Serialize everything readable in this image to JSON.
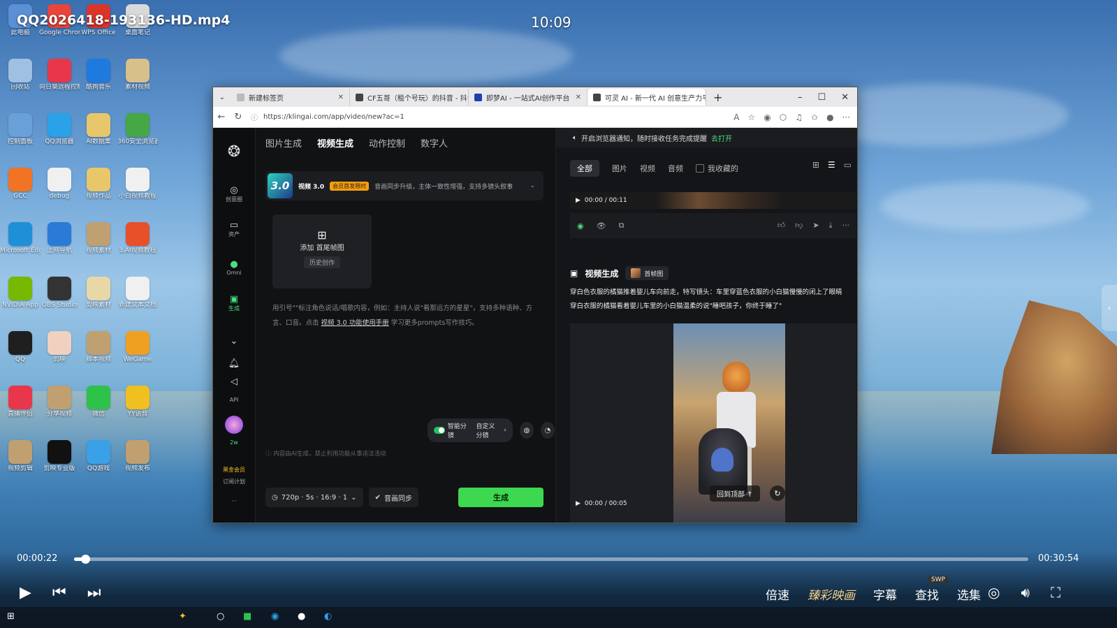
{
  "video": {
    "title": "QQ2026418-193136-HD.mp4",
    "clock": "10:09",
    "current_time": "00:00:22",
    "total_time": "00:30:54",
    "progress": 0.012
  },
  "desktop_icons": [
    {
      "label": "此电脑",
      "color": "#5b8fd6"
    },
    {
      "label": "Google Chrome",
      "color": "#e8453c"
    },
    {
      "label": "WPS Office",
      "color": "#d9352b"
    },
    {
      "label": "桌面笔记",
      "color": "#d9d9d9"
    },
    {
      "label": "回收站",
      "color": "#9fc0e0"
    },
    {
      "label": "向日葵远程控制",
      "color": "#e8374a"
    },
    {
      "label": "酷狗音乐",
      "color": "#1f7ae0"
    },
    {
      "label": "素材视频",
      "color": "#d8c08a"
    },
    {
      "label": "控制面板",
      "color": "#6aa0d8"
    },
    {
      "label": "QQ浏览器",
      "color": "#2aa2e8"
    },
    {
      "label": "AI数据集",
      "color": "#e8c76a"
    },
    {
      "label": "360安全浏览器",
      "color": "#45a845"
    },
    {
      "label": "GCC",
      "color": "#f07424"
    },
    {
      "label": "debug",
      "color": "#f0f0f0"
    },
    {
      "label": "视频作品",
      "color": "#e8c76a"
    },
    {
      "label": "小白视频教程",
      "color": "#f0f0f0"
    },
    {
      "label": "Microsoft Edge",
      "color": "#1f8fd8"
    },
    {
      "label": "上网导航",
      "color": "#2a7ad8"
    },
    {
      "label": "视频素材",
      "color": "#c0a070"
    },
    {
      "label": "3.AI视频教程",
      "color": "#e8502a"
    },
    {
      "label": "NVIDIA App",
      "color": "#76b900"
    },
    {
      "label": "OBS Studio",
      "color": "#333333"
    },
    {
      "label": "剪映素材",
      "color": "#e8d8a8"
    },
    {
      "label": "新建文本文档",
      "color": "#f0f0f0"
    },
    {
      "label": "QQ",
      "color": "#1f1f1f"
    },
    {
      "label": "剪映",
      "color": "#f0d0c0"
    },
    {
      "label": "脚本视频",
      "color": "#c0a070"
    },
    {
      "label": "WeGame",
      "color": "#f0a020"
    },
    {
      "label": "直播伴侣",
      "color": "#e8374a"
    },
    {
      "label": "分享视频",
      "color": "#c0a070"
    },
    {
      "label": "微信",
      "color": "#2dc24a"
    },
    {
      "label": "YY语音",
      "color": "#f0c020"
    },
    {
      "label": "视频剪辑",
      "color": "#c0a070"
    },
    {
      "label": "剪映专业版",
      "color": "#111111"
    },
    {
      "label": "QQ游戏",
      "color": "#3aa0e8"
    },
    {
      "label": "视频发布",
      "color": "#c0a070"
    }
  ],
  "browser": {
    "tabs": [
      {
        "label": "新建标签页",
        "active": false
      },
      {
        "label": "CF五哥（租个号玩）的抖音 - 抖音",
        "active": false
      },
      {
        "label": "即梦AI - 一站式AI创作平台",
        "active": false
      },
      {
        "label": "可灵 AI - 新一代 AI 创意生产力平",
        "active": true
      }
    ],
    "url": "https://klingai.com/app/video/new?ac=1"
  },
  "app": {
    "rail": [
      "创意圈",
      "资产",
      "Omni",
      "生成",
      "API",
      "2w",
      "黑金会员",
      "订阅计划"
    ],
    "nav": [
      "图片生成",
      "视频生成",
      "动作控制",
      "数字人"
    ],
    "model": {
      "version": "3.0",
      "name": "视频 3.0",
      "tag": "会员首发限时",
      "desc": "音画同步升级，主体一致性增强，支持多镜头叙事"
    },
    "upload_label": "添加 首尾帧图",
    "history_label": "历史创作",
    "hint_main": "用引号\"\"标注角色说话/唱歌内容，例如：主持人说\"看那远方的星星\"，支持多种语种、方言、口音。点击",
    "hint_link": "视频 3.0 功能使用手册",
    "hint_tail": "学习更多prompts写作技巧。",
    "smart_shot": "智能分镜",
    "custom_shot": "自定义分镜",
    "disclaimer": "内容由AI生成，禁止利用功能从事违法活动",
    "settings": "720p · 5s · 16:9 · 1",
    "audio_sync": "音画同步",
    "generate": "生成",
    "notice": "开启浏览器通知，随时接收任务完成提醒",
    "notice_link": "去打开",
    "filters": [
      "全部",
      "图片",
      "视频",
      "音频"
    ],
    "favorite": "我收藏的",
    "clip1_time": "00:00 / 00:11",
    "gen_title": "视频生成",
    "gen_chip": "首帧图",
    "gen_desc_1": "穿白色衣服的橘猫推着婴儿车向前走，特写镜头：车里穿蓝色衣服的小白猫慢慢的闭上了眼睛",
    "gen_desc_2": "穿白衣服的橘猫看着婴儿车里的小白猫温柔的说\"睡吧孩子，你终于睡了\"",
    "back_top": "回到顶部 ↑",
    "clip2_time": "00:00 / 00:05"
  },
  "player_controls": [
    "倍速",
    "臻彩映画",
    "字幕",
    "查找",
    "选集"
  ],
  "swp_badge": "SWP"
}
